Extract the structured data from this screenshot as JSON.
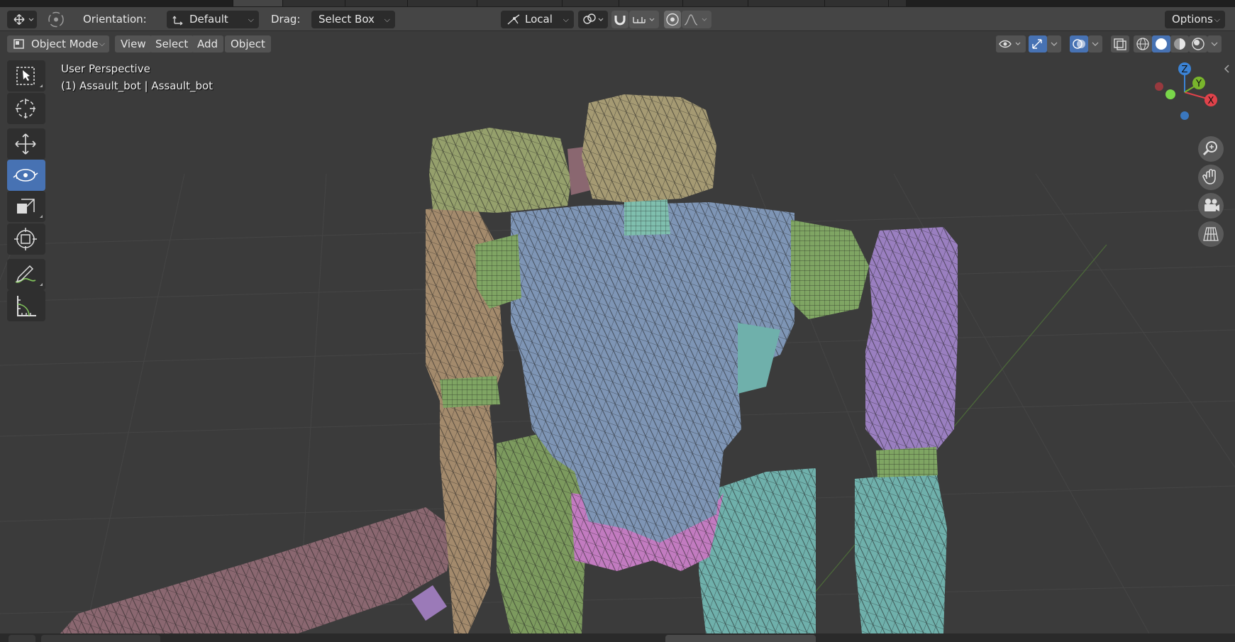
{
  "tool_header": {
    "orientation_label": "Orientation:",
    "orientation_value": "Default",
    "drag_label": "Drag:",
    "drag_value": "Select Box",
    "pivot_value": "Local",
    "options_label": "Options"
  },
  "viewport_header": {
    "mode": "Object Mode",
    "menus": [
      "View",
      "Select",
      "Add",
      "Object"
    ]
  },
  "overlay": {
    "view_name": "User Perspective",
    "object_info": "(1) Assault_bot | Assault_bot"
  },
  "gizmo": {
    "z": "Z",
    "y": "Y",
    "x": "X"
  },
  "colors": {
    "accent": "#4772b3",
    "axis_x": "#e0424a",
    "axis_y": "#79b52c",
    "axis_z": "#3b83d6",
    "body_blue": "#7e95b5",
    "leg_teal": "#6fb0ab",
    "arm_purple": "#9a7fc0",
    "joint_green": "#7fa563",
    "arm_tan": "#a08a6e",
    "head_khaki": "#a59a73",
    "gun_mauve": "#8a6770",
    "hip_pink": "#c27bc0"
  }
}
